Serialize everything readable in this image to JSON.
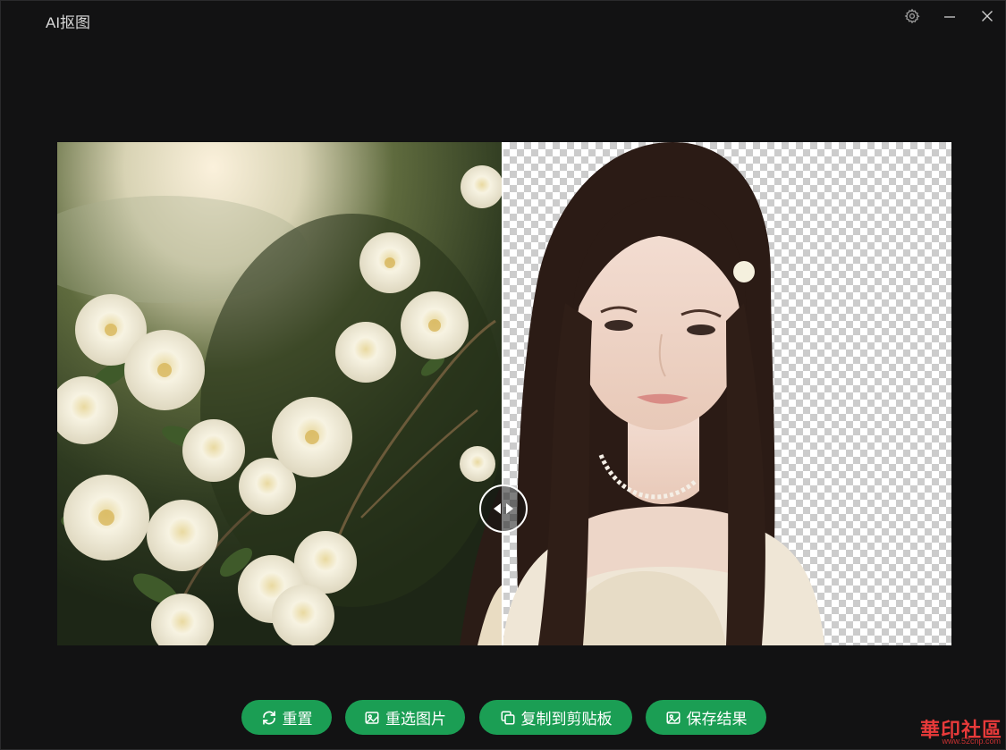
{
  "window": {
    "title": "AI抠图"
  },
  "actions": {
    "reset_label": "重置",
    "reselect_label": "重选图片",
    "copy_label": "复制到剪贴板",
    "save_label": "保存结果"
  },
  "watermark": {
    "text": "華印社區",
    "sub": "www.52cnp.com"
  },
  "colors": {
    "accent": "#1b9e54",
    "background": "#121213",
    "divider": "#ffffff"
  },
  "icons": {
    "settings": "gear-icon",
    "minimize": "minimize-icon",
    "close": "close-icon",
    "reset": "refresh-icon",
    "reselect": "image-icon",
    "copy": "copy-icon",
    "save": "image-save-icon",
    "handle_left": "arrow-left-icon",
    "handle_right": "arrow-right-icon"
  },
  "comparison": {
    "split_fraction": 0.498
  }
}
